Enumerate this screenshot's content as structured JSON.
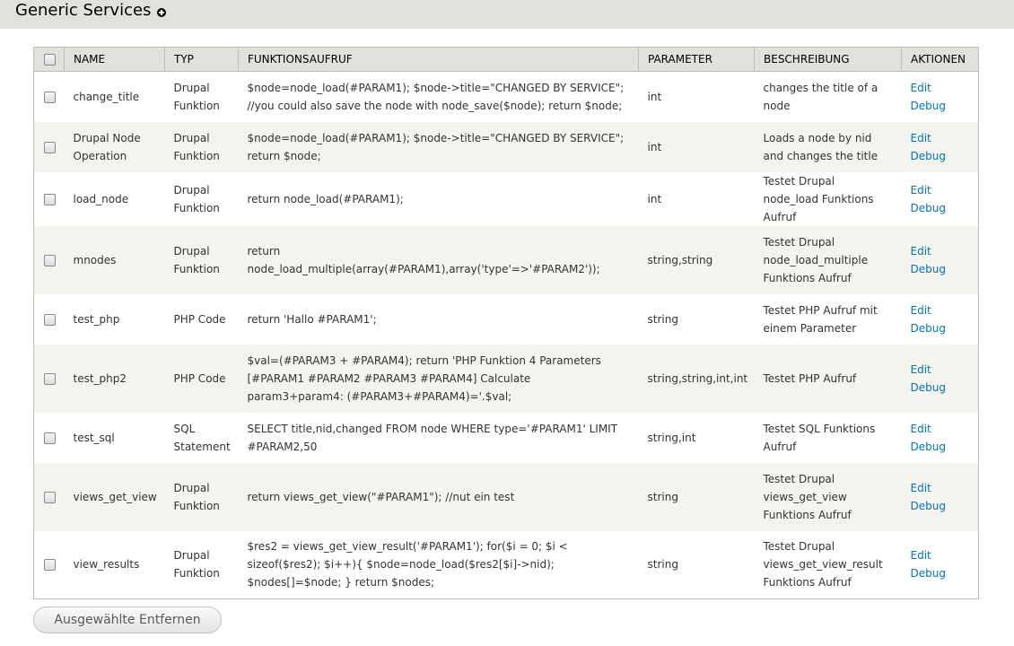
{
  "header": {
    "title": "Generic Services",
    "add_icon": "plus-circle-icon"
  },
  "table": {
    "columns": [
      "NAME",
      "TYP",
      "FUNKTIONSAUFRUF",
      "PARAMETER",
      "BESCHREIBUNG",
      "AKTIONEN"
    ],
    "rows": [
      {
        "name": "change_title",
        "typ": "Drupal Funktion",
        "call": "$node=node_load(#PARAM1); $node->title=\"CHANGED BY SERVICE\"; //you could also save the node with node_save($node); return $node;",
        "param": "int",
        "desc": "changes the title of a node",
        "edit": "Edit",
        "debug": "Debug"
      },
      {
        "name": "Drupal Node Operation",
        "typ": "Drupal Funktion",
        "call": "$node=node_load(#PARAM1); $node->title=\"CHANGED BY SERVICE\"; return $node;",
        "param": "int",
        "desc": "Loads a node by nid and changes the title",
        "edit": "Edit",
        "debug": "Debug"
      },
      {
        "name": "load_node",
        "typ": "Drupal Funktion",
        "call": "return node_load(#PARAM1);",
        "param": "int",
        "desc": "Testet Drupal node_load Funktions Aufruf",
        "edit": "Edit",
        "debug": "Debug"
      },
      {
        "name": "mnodes",
        "typ": "Drupal Funktion",
        "call": "return node_load_multiple(array(#PARAM1),array('type'=>'#PARAM2'));",
        "param": "string,string",
        "desc": "Testet Drupal node_load_multiple Funktions Aufruf",
        "edit": "Edit",
        "debug": "Debug"
      },
      {
        "name": "test_php",
        "typ": "PHP Code",
        "call": "return 'Hallo #PARAM1';",
        "param": "string",
        "desc": "Testet PHP Aufruf mit einem Parameter",
        "edit": "Edit",
        "debug": "Debug"
      },
      {
        "name": "test_php2",
        "typ": "PHP Code",
        "call": "$val=(#PARAM3 + #PARAM4); return 'PHP Funktion 4 Parameters [#PARAM1 #PARAM2 #PARAM3 #PARAM4] Calculate param3+param4: (#PARAM3+#PARAM4)='.$val;",
        "param": "string,string,int,int",
        "desc": "Testet PHP Aufruf",
        "edit": "Edit",
        "debug": "Debug"
      },
      {
        "name": "test_sql",
        "typ": "SQL Statement",
        "call": "SELECT title,nid,changed FROM node WHERE type='#PARAM1' LIMIT #PARAM2,50",
        "param": "string,int",
        "desc": "Testet SQL Funktions Aufruf",
        "edit": "Edit",
        "debug": "Debug"
      },
      {
        "name": "views_get_view",
        "typ": "Drupal Funktion",
        "call": "return views_get_view(\"#PARAM1\"); //nut ein test",
        "param": "string",
        "desc": "Testet Drupal views_get_view Funktions Aufruf",
        "edit": "Edit",
        "debug": "Debug"
      },
      {
        "name": "view_results",
        "typ": "Drupal Funktion",
        "call": "$res2 = views_get_view_result('#PARAM1'); for($i = 0; $i < sizeof($res2); $i++){ $node=node_load($res2[$i]->nid); $nodes[]=$node; } return $nodes;",
        "param": "string",
        "desc": "Testet Drupal views_get_view_result Funktions Aufruf",
        "edit": "Edit",
        "debug": "Debug"
      }
    ]
  },
  "actions": {
    "remove_label": "Ausgewählte Entfernen"
  },
  "colors": {
    "header_bg": "#e1e2dc",
    "row_alt_bg": "#f3f4ee",
    "link": "#0074bd"
  }
}
